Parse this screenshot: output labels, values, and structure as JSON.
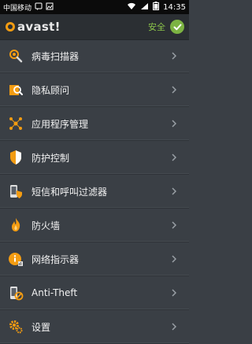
{
  "status_bar": {
    "carrier": "中国移动",
    "time": "14:35"
  },
  "app_bar": {
    "logo_text": "avast!",
    "status_label": "安全"
  },
  "menu": {
    "items": [
      {
        "label": "病毒扫描器",
        "icon": "virus-scanner-icon"
      },
      {
        "label": "隐私顾问",
        "icon": "privacy-advisor-icon"
      },
      {
        "label": "应用程序管理",
        "icon": "app-manager-icon"
      },
      {
        "label": "防护控制",
        "icon": "shield-control-icon"
      },
      {
        "label": "短信和呼叫过滤器",
        "icon": "sms-call-filter-icon"
      },
      {
        "label": "防火墙",
        "icon": "firewall-icon"
      },
      {
        "label": "网络指示器",
        "icon": "network-meter-icon"
      },
      {
        "label": "Anti-Theft",
        "icon": "anti-theft-icon"
      },
      {
        "label": "设置",
        "icon": "settings-gear-icon"
      }
    ]
  },
  "colors": {
    "background": "#3a3f45",
    "accent_orange": "#f39c12",
    "secure_green": "#7cb342"
  }
}
